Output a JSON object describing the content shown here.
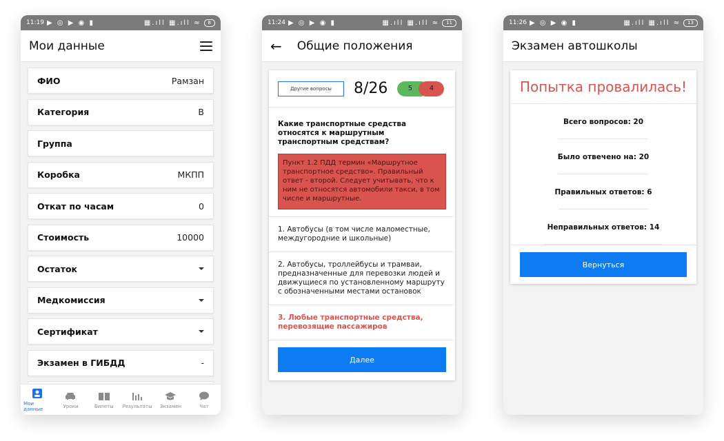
{
  "screen1": {
    "status": {
      "time": "11:19",
      "battery": "8"
    },
    "title": "Мои данные",
    "rows": [
      {
        "label": "ФИО",
        "value": "Рамзан"
      },
      {
        "label": "Категория",
        "value": "В"
      },
      {
        "label": "Группа",
        "value": ""
      },
      {
        "label": "Коробка",
        "value": "МКПП"
      },
      {
        "label": "Откат по часам",
        "value": "0"
      },
      {
        "label": "Стоимость",
        "value": "10000"
      },
      {
        "label": "Остаток",
        "value": ""
      },
      {
        "label": "Медкомиссия",
        "value": ""
      },
      {
        "label": "Сертификат",
        "value": ""
      },
      {
        "label": "Экзамен в ГИБДД",
        "value": "-"
      }
    ],
    "nav": [
      "Мои данные",
      "Уроки",
      "Билеты",
      "Результаты",
      "Экзамен",
      "Чат"
    ]
  },
  "screen2": {
    "status": {
      "time": "11:24",
      "battery": "11"
    },
    "title": "Общие положения",
    "other_questions": "Другие вопросы",
    "counter": "8/26",
    "correct_count": "5",
    "wrong_count": "4",
    "question": "Какие транспортные средства относятся к маршрутным транспортным средствам?",
    "hint": "Пункт 1.2 ПДД термин «Маршрутное транспортное средство». Правильный ответ - второй. Следует учитывать, что к ним не относятся автомобили такси, в том числе и маршрутные.",
    "answers": [
      "1. Автобусы (в том числе маломестные, междугородние и школьные)",
      "2. Автобусы, троллейбусы и трамваи, предназначенные для перевозки людей и движущиеся по установленному маршруту с обозначенными местами остановок",
      "3. Любые транспортные средства, перевозящие пассажиров"
    ],
    "next": "Далее"
  },
  "screen3": {
    "status": {
      "time": "11:26",
      "battery": "13"
    },
    "title": "Экзамен автошколы",
    "result": "Попытка провалилась!",
    "stats": [
      "Всего вопросов: 20",
      "Было отвечено на: 20",
      "Правильных ответов: 6",
      "Неправильных ответов: 14"
    ],
    "back": "Вернуться"
  },
  "colors": {
    "accent": "#0d7cf2",
    "danger": "#d9534f",
    "success": "#5cb85c",
    "statusbar": "#7a7a7a"
  }
}
